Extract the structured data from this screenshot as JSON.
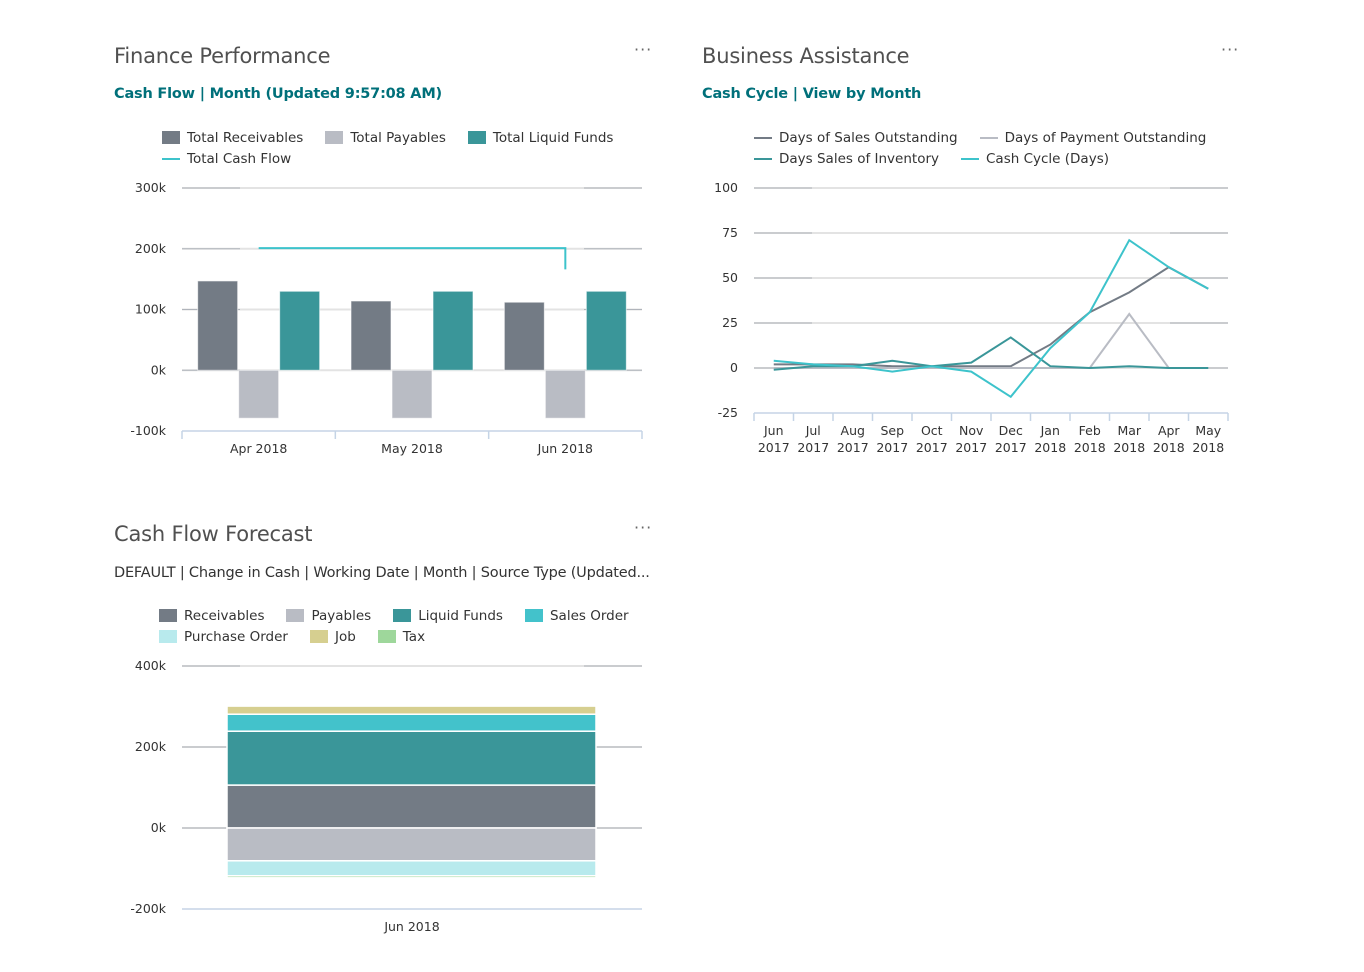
{
  "finance": {
    "title": "Finance Performance",
    "menu": "···",
    "subtitle": "Cash Flow | Month (Updated 9:57:08 AM)",
    "legend": [
      {
        "label": "Total Receivables",
        "kind": "box",
        "color": "#737b85"
      },
      {
        "label": "Total Payables",
        "kind": "box",
        "color": "#b9bcc4"
      },
      {
        "label": "Total Liquid Funds",
        "kind": "box",
        "color": "#3a9699"
      },
      {
        "label": "Total Cash Flow",
        "kind": "line",
        "color": "#3dc3cb"
      }
    ]
  },
  "business": {
    "title": "Business Assistance",
    "menu": "···",
    "subtitle": "Cash Cycle | View by Month",
    "legend": [
      {
        "label": "Days of Sales Outstanding",
        "kind": "line",
        "color": "#737b85"
      },
      {
        "label": "Days of Payment Outstanding",
        "kind": "line",
        "color": "#b9bcc4"
      },
      {
        "label": "Days Sales of Inventory",
        "kind": "line",
        "color": "#3a9699"
      },
      {
        "label": "Cash Cycle (Days)",
        "kind": "line",
        "color": "#3dc3cb"
      }
    ]
  },
  "forecast": {
    "title": "Cash Flow Forecast",
    "menu": "···",
    "subtitle": "DEFAULT | Change in Cash | Working Date | Month | Source Type (Updated...",
    "legend": [
      {
        "label": "Receivables",
        "kind": "box",
        "color": "#737b85"
      },
      {
        "label": "Payables",
        "kind": "box",
        "color": "#b9bcc4"
      },
      {
        "label": "Liquid Funds",
        "kind": "box",
        "color": "#3a9699"
      },
      {
        "label": "Sales Order",
        "kind": "box",
        "color": "#43c2cb"
      },
      {
        "label": "Purchase Order",
        "kind": "box",
        "color": "#b8eaed"
      },
      {
        "label": "Job",
        "kind": "box",
        "color": "#d6cf90"
      },
      {
        "label": "Tax",
        "kind": "box",
        "color": "#9ed79b"
      }
    ]
  },
  "chart_data": [
    {
      "id": "finance",
      "type": "bar",
      "title": "Cash Flow | Month (Updated 9:57:08 AM)",
      "xlabel": "",
      "ylabel": "",
      "categories": [
        "Apr 2018",
        "May 2018",
        "Jun 2018"
      ],
      "ylim": [
        -100000,
        300000
      ],
      "yticks": [
        300000,
        200000,
        100000,
        0,
        -100000
      ],
      "ytick_labels": [
        "300k",
        "200k",
        "100k",
        "0k",
        "-100k"
      ],
      "grid": true,
      "legend_position": "top",
      "series": [
        {
          "name": "Total Receivables",
          "type": "bar",
          "color": "#737b85",
          "values": [
            147000,
            114000,
            112000
          ]
        },
        {
          "name": "Total Payables",
          "type": "bar",
          "color": "#b9bcc4",
          "values": [
            -79000,
            -79000,
            -79000
          ]
        },
        {
          "name": "Total Liquid Funds",
          "type": "bar",
          "color": "#3a9699",
          "values": [
            130000,
            130000,
            130000
          ]
        },
        {
          "name": "Total Cash Flow",
          "type": "step-line",
          "color": "#3dc3cb",
          "values": [
            201000,
            201000,
            166000
          ]
        }
      ]
    },
    {
      "id": "business",
      "type": "line",
      "title": "Cash Cycle | View by Month",
      "xlabel": "",
      "ylabel": "",
      "categories": [
        "Jun 2017",
        "Jul 2017",
        "Aug 2017",
        "Sep 2017",
        "Oct 2017",
        "Nov 2017",
        "Dec 2017",
        "Jan 2018",
        "Feb 2018",
        "Mar 2018",
        "Apr 2018",
        "May 2018"
      ],
      "ylim": [
        -25,
        100
      ],
      "yticks": [
        100,
        75,
        50,
        25,
        0,
        -25
      ],
      "ytick_labels": [
        "100",
        "75",
        "50",
        "25",
        "0",
        "-25"
      ],
      "grid": true,
      "legend_position": "top",
      "series": [
        {
          "name": "Days of Sales Outstanding",
          "color": "#737b85",
          "values": [
            2,
            2,
            2,
            1,
            1,
            1,
            1,
            13,
            31,
            42,
            56,
            44
          ]
        },
        {
          "name": "Days of Payment Outstanding",
          "color": "#b9bcc4",
          "values": [
            0,
            0,
            0,
            0,
            0,
            0,
            0,
            0,
            0,
            30,
            0,
            0
          ]
        },
        {
          "name": "Days Sales of Inventory",
          "color": "#3a9699",
          "values": [
            -1,
            1,
            1,
            4,
            1,
            3,
            17,
            1,
            0,
            1,
            0,
            0
          ]
        },
        {
          "name": "Cash Cycle (Days)",
          "color": "#3dc3cb",
          "values": [
            4,
            2,
            1,
            -2,
            1,
            -2,
            -16,
            11,
            31,
            71,
            56,
            44
          ]
        }
      ]
    },
    {
      "id": "forecast",
      "type": "bar",
      "stacked": true,
      "title": "DEFAULT | Change in Cash | Working Date | Month | Source Type",
      "xlabel": "",
      "ylabel": "",
      "categories": [
        "Jun 2018"
      ],
      "ylim": [
        -200000,
        400000
      ],
      "yticks": [
        400000,
        200000,
        0,
        -200000
      ],
      "ytick_labels": [
        "400k",
        "200k",
        "0k",
        "-200k"
      ],
      "grid": true,
      "legend_position": "top",
      "series": [
        {
          "name": "Receivables",
          "color": "#737b85",
          "values": [
            106000
          ]
        },
        {
          "name": "Payables",
          "color": "#b9bcc4",
          "values": [
            -81000
          ]
        },
        {
          "name": "Liquid Funds",
          "color": "#3a9699",
          "values": [
            133000
          ]
        },
        {
          "name": "Sales Order",
          "color": "#43c2cb",
          "values": [
            42000
          ]
        },
        {
          "name": "Purchase Order",
          "color": "#b8eaed",
          "values": [
            -37000
          ]
        },
        {
          "name": "Job",
          "color": "#d6cf90",
          "values": [
            20000
          ]
        },
        {
          "name": "Tax",
          "color": "#9ed79b",
          "values": [
            -5000
          ]
        }
      ]
    }
  ]
}
